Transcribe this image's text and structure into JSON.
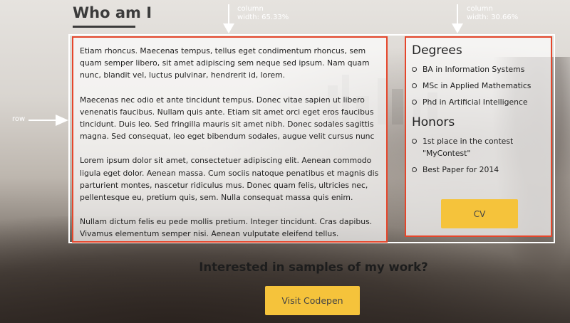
{
  "header": {
    "title": "Who am I"
  },
  "annotations": {
    "column_main": [
      "column",
      "width: 65.33%"
    ],
    "column_side": [
      "column",
      "width: 30.66%"
    ],
    "row": "row"
  },
  "main": {
    "paragraphs": [
      "Etiam rhoncus. Maecenas tempus, tellus eget condimentum rhoncus, sem quam semper libero, sit amet adipiscing sem neque sed ipsum. Nam quam nunc, blandit vel, luctus pulvinar, hendrerit id, lorem.",
      "Maecenas nec odio et ante tincidunt tempus. Donec vitae sapien ut libero venenatis faucibus. Nullam quis ante. Etiam sit amet orci eget eros faucibus tincidunt. Duis leo. Sed fringilla mauris sit amet nibh. Donec sodales sagittis magna. Sed consequat, leo eget bibendum sodales, augue velit cursus nunc",
      "Lorem ipsum dolor sit amet, consectetuer adipiscing elit. Aenean commodo ligula eget dolor. Aenean massa. Cum sociis natoque penatibus et magnis dis parturient montes, nascetur ridiculus mus. Donec quam felis, ultricies nec, pellentesque eu, pretium quis, sem. Nulla consequat massa quis enim.",
      "Nullam dictum felis eu pede mollis pretium. Integer tincidunt. Cras dapibus. Vivamus elementum semper nisi. Aenean vulputate eleifend tellus."
    ]
  },
  "sidebar": {
    "degrees_title": "Degrees",
    "degrees": [
      "BA in Information Systems",
      "MSc in Applied Mathematics",
      "Phd in Artificial Intelligence"
    ],
    "honors_title": "Honors",
    "honors": [
      "1st place in the contest \"MyContest\"",
      "Best Paper for 2014"
    ],
    "cv_label": "CV"
  },
  "footer": {
    "cta_text": "Interested in samples of my work?",
    "button_label": "Visit Codepen"
  },
  "colors": {
    "accent": "#f5c33b",
    "outline": "#e5462b"
  }
}
